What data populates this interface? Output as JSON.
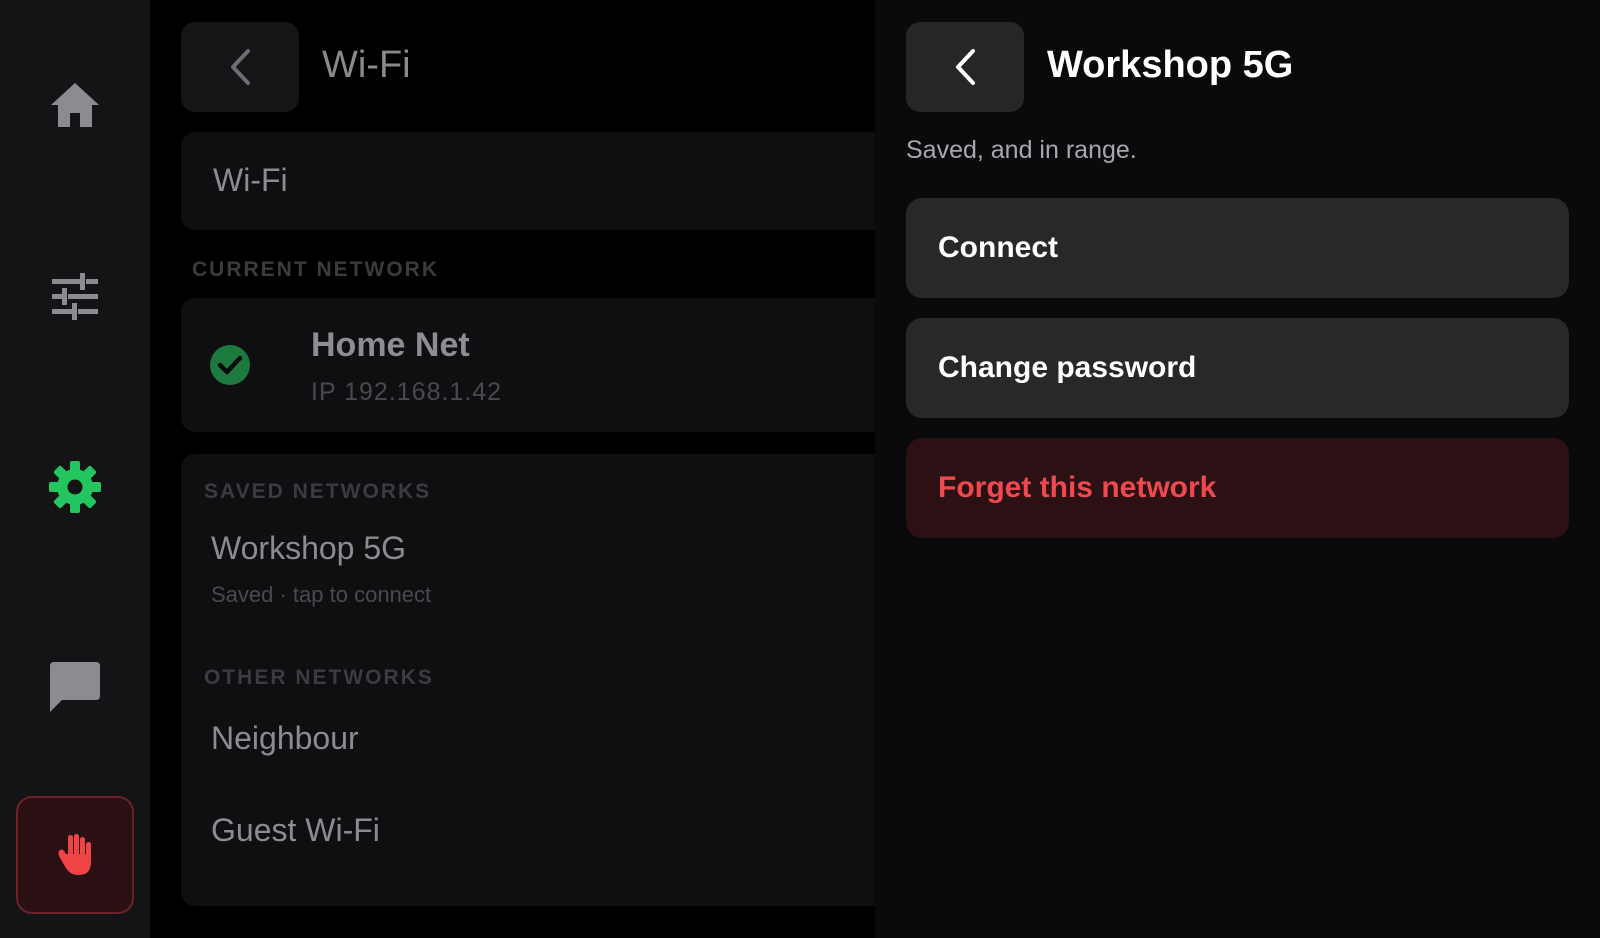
{
  "sidebar": {
    "items": [
      {
        "name": "home",
        "icon": "home-icon"
      },
      {
        "name": "controls",
        "icon": "sliders-icon"
      },
      {
        "name": "settings",
        "icon": "gear-icon",
        "active": true
      },
      {
        "name": "messages",
        "icon": "chat-icon"
      },
      {
        "name": "emergency-stop",
        "icon": "hand-stop-icon"
      }
    ],
    "active_color": "#22c55e",
    "estop_color": "#ef4444"
  },
  "wifi_panel": {
    "title": "Wi-Fi",
    "toggle_label": "Wi-Fi",
    "current_section": "CURRENT NETWORK",
    "current": {
      "name": "Home Net",
      "ip": "IP  192.168.1.42"
    },
    "saved_section": "SAVED NETWORKS",
    "saved": [
      {
        "name": "Workshop 5G",
        "sub": "Saved · tap to connect"
      }
    ],
    "other_section": "OTHER NETWORKS",
    "other": [
      {
        "name": "Neighbour"
      },
      {
        "name": "Guest Wi-Fi"
      }
    ]
  },
  "detail": {
    "title": "Workshop 5G",
    "subtitle": "Saved, and in range.",
    "actions": {
      "connect": "Connect",
      "change_password": "Change password",
      "forget": "Forget this network"
    },
    "danger_color": "#f0484f"
  }
}
